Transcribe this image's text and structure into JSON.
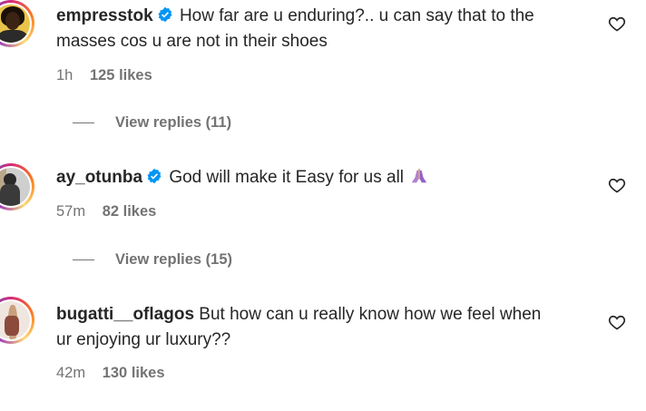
{
  "comments": [
    {
      "username": "empresstok",
      "verified": true,
      "text_line1": "How far are u enduring?.. u can say that to the",
      "text_line2": "masses cos u are not in their shoes",
      "time": "1h",
      "likes": "125 likes",
      "replies": "View replies (11)"
    },
    {
      "username": "ay_otunba",
      "verified": true,
      "text_line1": "God will make it Easy for us all",
      "emoji": "praying-hands",
      "time": "57m",
      "likes": "82 likes",
      "replies": "View replies (15)"
    },
    {
      "username": "bugatti__oflagos",
      "verified": false,
      "text_line1": "But how can u really know how we feel when",
      "text_line2": "ur enjoying ur luxury??",
      "time": "42m",
      "likes": "130 likes"
    }
  ],
  "icons": {
    "like": "heart-outline-icon",
    "verified": "verified-badge-icon"
  },
  "colors": {
    "verified": "#0095f6",
    "secondary_text": "#737373",
    "primary_text": "#262626"
  }
}
